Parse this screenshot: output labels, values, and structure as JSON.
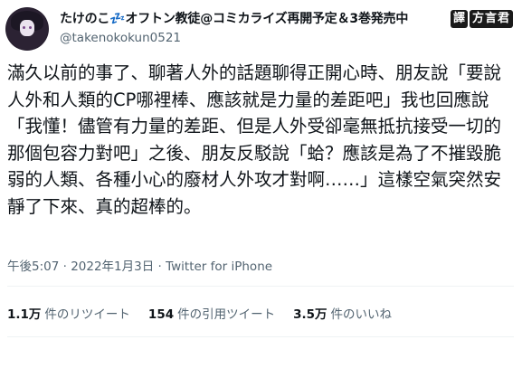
{
  "user": {
    "display_name": "たけのこ💤オフトン教徒@コミカライズ再開予定＆3巻発売中",
    "handle": "@takenokokun0521"
  },
  "watermark": {
    "badge_a": "譯",
    "badge_b": "方言君"
  },
  "tweet": {
    "text": "滿久以前的事了、聊著人外的話題聊得正開心時、朋友說「要說人外和人類的CP哪裡棒、應該就是力量的差距吧」我也回應說「我懂！儘管有力量的差距、但是人外受卻毫無抵抗接受一切的那個包容力對吧」之後、朋友反駁說「蛤？應該是為了不摧毀脆弱的人類、各種小心的廢材人外攻才對啊……」這樣空氣突然安靜了下來、真的超棒的。"
  },
  "meta": {
    "timestamp": "午後5:07 · 2022年1月3日 · Twitter for iPhone"
  },
  "stats": {
    "retweets": {
      "count": "1.1万",
      "label": "件のリツイート"
    },
    "quotes": {
      "count": "154",
      "label": "件の引用ツイート"
    },
    "likes": {
      "count": "3.5万",
      "label": "件のいいね"
    }
  }
}
